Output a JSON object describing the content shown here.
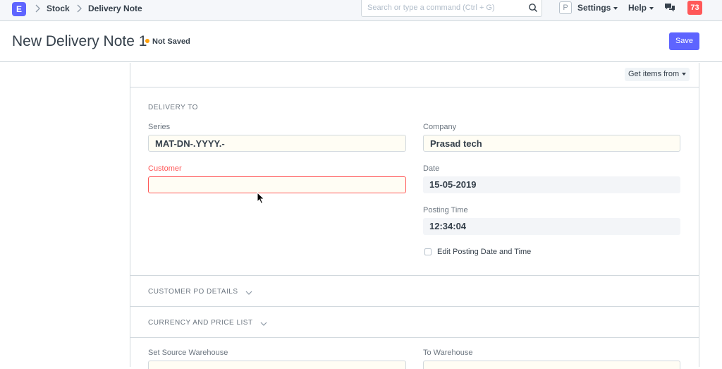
{
  "navbar": {
    "logo_letter": "E",
    "breadcrumbs": [
      "Stock",
      "Delivery Note"
    ],
    "search_placeholder": "Search or type a command (Ctrl + G)",
    "avatar_letter": "P",
    "settings_label": "Settings",
    "help_label": "Help",
    "notification_count": "73",
    "icons": [
      "chevron-right-icon",
      "search-icon",
      "chat-icon"
    ]
  },
  "page": {
    "title": "New Delivery Note 1",
    "status": "Not Saved",
    "save_label": "Save"
  },
  "toolbar": {
    "get_items_label": "Get items from"
  },
  "delivery_to": {
    "heading": "DELIVERY TO",
    "series_label": "Series",
    "series_value": "MAT-DN-.YYYY.-",
    "customer_label": "Customer",
    "customer_value": "",
    "company_label": "Company",
    "company_value": "Prasad tech",
    "date_label": "Date",
    "date_value": "15-05-2019",
    "posting_time_label": "Posting Time",
    "posting_time_value": "12:34:04",
    "edit_posting_label": "Edit Posting Date and Time",
    "edit_posting_checked": false
  },
  "sections": {
    "customer_po": "CUSTOMER PO DETAILS",
    "currency": "CURRENCY AND PRICE LIST"
  },
  "warehouse": {
    "source_label": "Set Source Warehouse",
    "target_label": "To Warehouse"
  },
  "colors": {
    "primary": "#5e64ff",
    "danger": "#ff5858",
    "indicator_orange": "#ffa00a"
  }
}
